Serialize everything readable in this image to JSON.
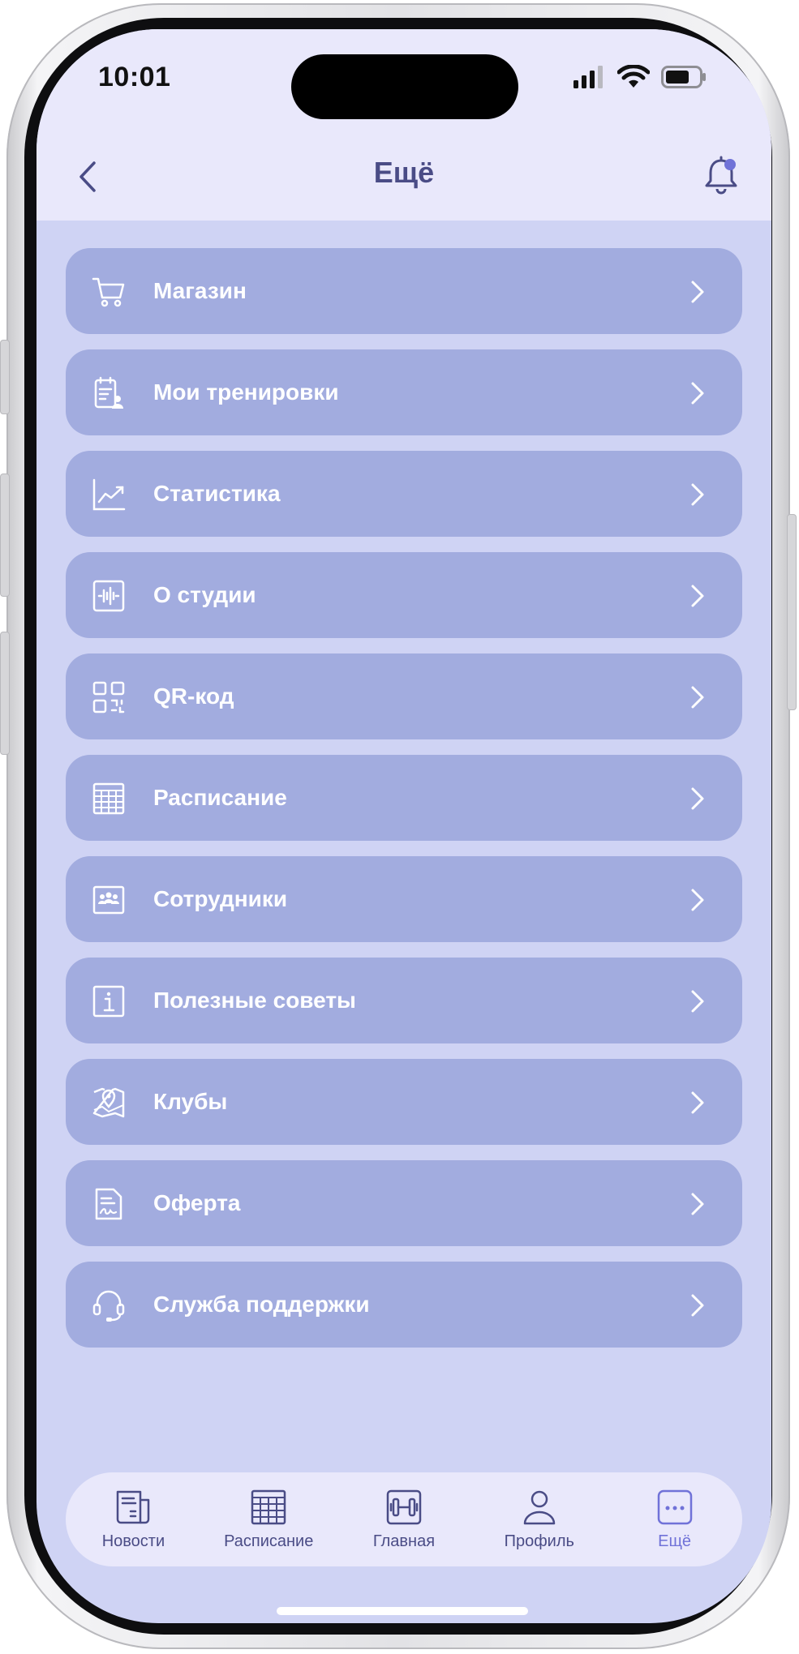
{
  "status_bar": {
    "time": "10:01"
  },
  "header": {
    "title": "Ещё"
  },
  "menu": [
    {
      "label": "Магазин",
      "icon": "cart-icon"
    },
    {
      "label": "Мои тренировки",
      "icon": "clipboard-user-icon"
    },
    {
      "label": "Статистика",
      "icon": "chart-line-icon"
    },
    {
      "label": "О студии",
      "icon": "audio-wave-icon"
    },
    {
      "label": "QR-код",
      "icon": "qr-code-icon"
    },
    {
      "label": "Расписание",
      "icon": "calendar-grid-icon"
    },
    {
      "label": "Сотрудники",
      "icon": "team-icon"
    },
    {
      "label": "Полезные советы",
      "icon": "info-icon"
    },
    {
      "label": "Клубы",
      "icon": "map-pin-icon"
    },
    {
      "label": "Оферта",
      "icon": "document-signature-icon"
    },
    {
      "label": "Служба поддержки",
      "icon": "headset-icon"
    }
  ],
  "tabbar": [
    {
      "label": "Новости",
      "icon": "news-icon",
      "active": false
    },
    {
      "label": "Расписание",
      "icon": "calendar-grid-icon",
      "active": false
    },
    {
      "label": "Главная",
      "icon": "dumbbell-icon",
      "active": false
    },
    {
      "label": "Профиль",
      "icon": "user-icon",
      "active": false
    },
    {
      "label": "Ещё",
      "icon": "more-icon",
      "active": true
    }
  ],
  "colors": {
    "screen_bg": "#cfd3f4",
    "header_bg": "#e9e8fb",
    "menu_item_bg": "#a2acdf",
    "title_text": "#4a4c86",
    "accent": "#7072d8"
  }
}
